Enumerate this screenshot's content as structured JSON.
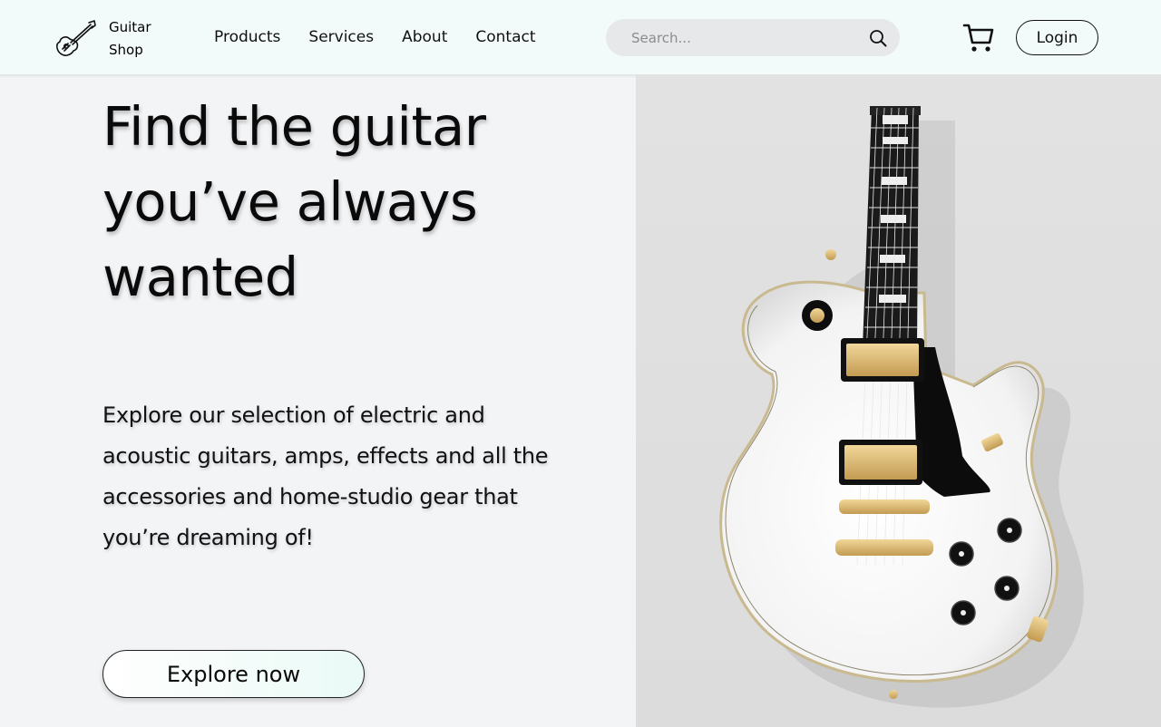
{
  "header": {
    "logo_line1": "Guitar",
    "logo_line2": "Shop",
    "nav": [
      "Products",
      "Services",
      "About",
      "Contact"
    ],
    "search_placeholder": "Search...",
    "login_label": "Login"
  },
  "hero": {
    "title": "Find the guitar you’ve always wanted",
    "description": "Explore our selection of electric and acoustic guitars, amps, effects and all the accessories and home-studio gear that you’re dreaming of!",
    "cta_label": "Explore now"
  },
  "colors": {
    "header_bg": "#f3fbfa",
    "page_bg": "#f3f4f6",
    "image_bg": "#e0e0e0",
    "guitar_body": "#fafafa",
    "guitar_hardware": "#d9b36a"
  },
  "icons": [
    "guitar-logo-icon",
    "search-icon",
    "cart-icon"
  ]
}
